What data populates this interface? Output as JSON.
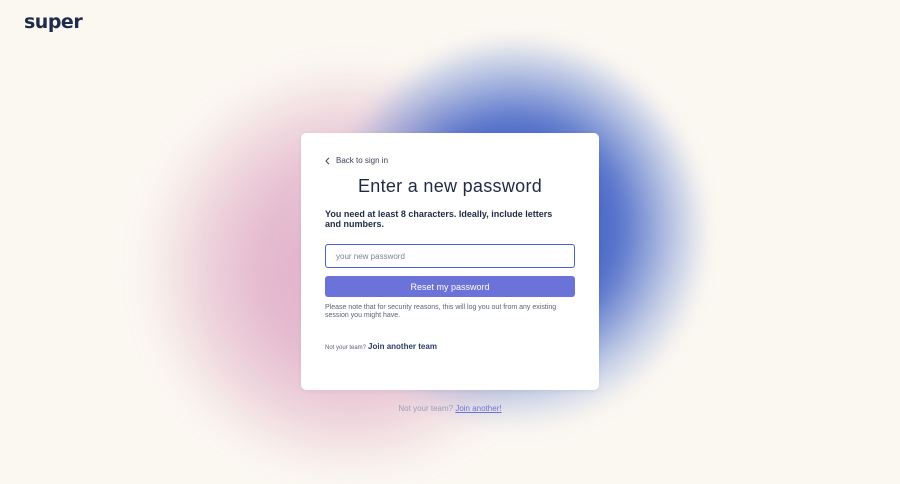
{
  "app": {
    "logo_text": "super"
  },
  "card": {
    "back_label": "Back to sign in",
    "title": "Enter a new password",
    "intro": "You need at least 8 characters. Ideally, include letters and numbers.",
    "password_placeholder": "your new password",
    "password_value": "",
    "reset_label": "Reset my password",
    "note": "Please note that for security reasons, this will log you out from any existing session you might have.",
    "not_team_prefix": "Not your team?",
    "join_team_label": "Join another team"
  },
  "footer": {
    "prefix": "Not your team?",
    "join_label": "Join another!"
  },
  "icons": {
    "back": "chevron-left-icon"
  },
  "colors": {
    "accent": "#6b73d9",
    "input_border": "#4a5fd6",
    "text_primary": "#1f2a44",
    "background": "#fbf7f1"
  }
}
